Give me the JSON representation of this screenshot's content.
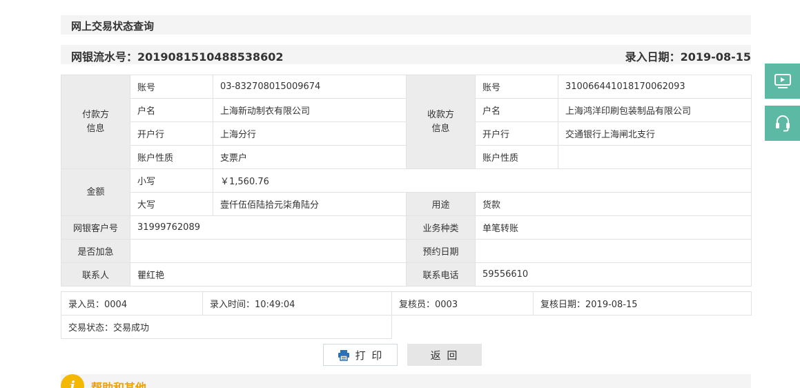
{
  "page": {
    "title": "网上交易状态查询",
    "serial_label": "网银流水号：2019081510488538602",
    "entry_date_label": "录入日期：2019-08-15"
  },
  "payer": {
    "heading": "付款方\n信息",
    "account_label": "账号",
    "account": "03-832708015009674",
    "name_label": "户名",
    "name": "上海新动制衣有限公司",
    "bank_label": "开户行",
    "bank": "上海分行",
    "type_label": "账户性质",
    "type": "支票户"
  },
  "payee": {
    "heading": "收款方\n信息",
    "account_label": "账号",
    "account": "31006644101817006209​3",
    "name_label": "户名",
    "name": "上海鸿洋印刷包装制品有限公司",
    "bank_label": "开户行",
    "bank": "交通银行上海闸北支行",
    "type_label": "账户性质",
    "type": ""
  },
  "amount": {
    "heading": "金额",
    "lower_label": "小写",
    "lower": "￥1,560.76",
    "upper_label": "大写",
    "upper": "壹仟伍佰陆拾元柒角陆分",
    "purpose_label": "用途",
    "purpose": "货款"
  },
  "details": {
    "client_no_label": "网银客户号",
    "client_no": "31999762089",
    "biz_type_label": "业务种类",
    "biz_type": "单笔转账",
    "urgent_label": "是否加急",
    "urgent": "",
    "scheduled_label": "预约日期",
    "scheduled": "",
    "contact_label": "联系人",
    "contact": "瞿红艳",
    "phone_label": "联系电话",
    "phone": "59556610"
  },
  "audit": {
    "entry_operator": "录入员：0004",
    "entry_time": "录入时间：10:49:04",
    "reviewer": "复核员：0003",
    "review_date": "复核日期：2019-08-15",
    "status": "交易状态：交易成功"
  },
  "buttons": {
    "print": "打 印",
    "back": "返 回"
  },
  "help": {
    "icon_glyph": "i",
    "title": "帮助和其他"
  },
  "colors": {
    "accent": "#5bb9a4",
    "help_icon": "#f5b800",
    "help_title": "#f0a000"
  }
}
